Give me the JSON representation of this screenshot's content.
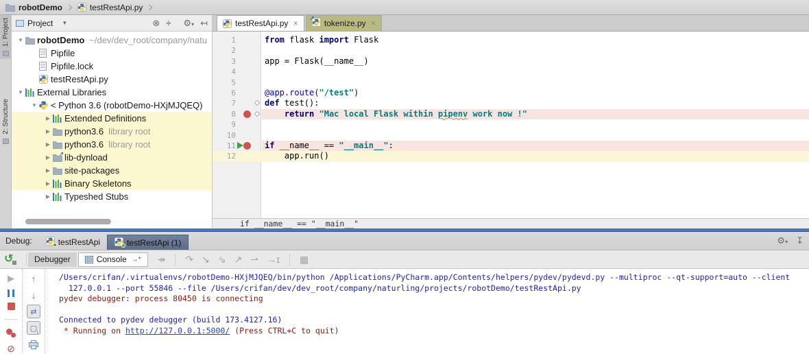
{
  "colors": {
    "keyword": "#000080",
    "string": "#008080",
    "decorator": "#0000b2",
    "breakpoint_line_bg": "#f8e4e0",
    "caret_line_bg": "#fcf6d8",
    "tree_highlight_bg": "#fbf8cf",
    "inactive_tab_bg": "#b9ba7f",
    "selected_debug_tab_bg": "#5d6e88",
    "splitter_accent": "#4678be",
    "console_stdout": "#1e23be",
    "console_stderr": "#8b1a10",
    "breakpoint_red": "#d25252"
  },
  "breadcrumb": {
    "items": [
      {
        "label": "robotDemo",
        "icon": "folder",
        "bold": true
      },
      {
        "label": "testRestApi.py",
        "icon": "python-file",
        "bold": false
      }
    ]
  },
  "tool_strip": {
    "tabs": [
      {
        "label": "1: Project",
        "active": true
      },
      {
        "label": "2: Structure",
        "active": false
      }
    ]
  },
  "project": {
    "title": "Project",
    "header_icons": [
      "locate",
      "collapse-all",
      "sep",
      "gear",
      "hide-left"
    ],
    "tree": [
      {
        "label": "robotDemo",
        "suffix": "~/dev/dev_root/company/natu",
        "icon": "folder",
        "chevron": "down",
        "level": 0,
        "bold": true,
        "hl": false
      },
      {
        "label": "Pipfile",
        "icon": "file",
        "chevron": "",
        "level": 1,
        "hl": false
      },
      {
        "label": "Pipfile.lock",
        "icon": "file",
        "chevron": "",
        "level": 1,
        "hl": false
      },
      {
        "label": "testRestApi.py",
        "icon": "python-file",
        "chevron": "",
        "level": 1,
        "hl": false
      },
      {
        "label": "External Libraries",
        "icon": "library",
        "chevron": "down",
        "level": 0,
        "hl": false
      },
      {
        "label": "< Python 3.6 (robotDemo-HXjMJQEQ)",
        "icon": "python-logo",
        "chevron": "down",
        "level": 1,
        "hl": false
      },
      {
        "label": "Extended Definitions",
        "icon": "library",
        "chevron": "right",
        "level": 2,
        "hl": true
      },
      {
        "label": "python3.6",
        "suffix": "library root",
        "icon": "folder",
        "chevron": "right",
        "level": 2,
        "hl": true
      },
      {
        "label": "python3.6",
        "suffix": "library root",
        "icon": "folder",
        "chevron": "right",
        "level": 2,
        "hl": true
      },
      {
        "label": "lib-dynload",
        "icon": "folder-link",
        "chevron": "right",
        "level": 2,
        "hl": true
      },
      {
        "label": "site-packages",
        "icon": "folder",
        "chevron": "right",
        "level": 2,
        "hl": true
      },
      {
        "label": "Binary Skeletons",
        "icon": "library",
        "chevron": "right",
        "level": 2,
        "hl": true
      },
      {
        "label": "Typeshed Stubs",
        "icon": "library",
        "chevron": "right",
        "level": 2,
        "hl": false
      }
    ]
  },
  "editor": {
    "tabs": [
      {
        "label": "testRestApi.py",
        "icon": "python-file",
        "active": true
      },
      {
        "label": "tokenize.py",
        "icon": "python-file-link",
        "active": false
      }
    ],
    "close_glyph": "✕",
    "lines": [
      {
        "num": 1,
        "tokens": [
          {
            "t": "from",
            "c": "kw"
          },
          {
            "t": " flask ",
            "c": ""
          },
          {
            "t": "import",
            "c": "kw"
          },
          {
            "t": " Flask",
            "c": ""
          }
        ]
      },
      {
        "num": 2,
        "tokens": []
      },
      {
        "num": 3,
        "tokens": [
          {
            "t": "app = Flask(__name__)",
            "c": ""
          }
        ]
      },
      {
        "num": 4,
        "tokens": []
      },
      {
        "num": 5,
        "tokens": []
      },
      {
        "num": 6,
        "tokens": [
          {
            "t": "@app.route(",
            "c": "dec"
          },
          {
            "t": "\"/test\"",
            "c": "str"
          },
          {
            "t": ")",
            "c": "dec"
          }
        ]
      },
      {
        "num": 7,
        "tokens": [
          {
            "t": "def",
            "c": "kw"
          },
          {
            "t": " test():",
            "c": ""
          }
        ],
        "fold": "close"
      },
      {
        "num": 8,
        "tokens": [
          {
            "t": "    ",
            "c": ""
          },
          {
            "t": "return",
            "c": "kw"
          },
          {
            "t": " ",
            "c": ""
          },
          {
            "t": "\"Mac local Flask within ",
            "c": "str"
          },
          {
            "t": "pipenv",
            "c": "str typo"
          },
          {
            "t": " work now !\"",
            "c": "str"
          }
        ],
        "breakpoint": true,
        "band": "pink",
        "fold": "open"
      },
      {
        "num": 9,
        "tokens": []
      },
      {
        "num": 10,
        "tokens": []
      },
      {
        "num": 11,
        "tokens": [
          {
            "t": "if",
            "c": "kw"
          },
          {
            "t": " __name__ == ",
            "c": ""
          },
          {
            "t": "\"__main__\"",
            "c": "str"
          },
          {
            "t": ":",
            "c": ""
          }
        ],
        "breakpoint": true,
        "exec": true,
        "band": "pink"
      },
      {
        "num": 12,
        "tokens": [
          {
            "t": "    app.run()",
            "c": ""
          }
        ],
        "band": "yellow"
      }
    ],
    "context_bar": "if __name__ == \"__main__\""
  },
  "debug": {
    "label": "Debug:",
    "session_tabs": [
      {
        "label": "testRestApi",
        "icon": "python-run",
        "active": false
      },
      {
        "label": "testRestApi (1)",
        "icon": "python-run",
        "active": true
      }
    ],
    "header_icons": [
      "gear",
      "hide-down"
    ],
    "view_tabs": [
      {
        "label": "Debugger",
        "active": false,
        "icon": ""
      },
      {
        "label": "Console",
        "active": true,
        "icon": "console",
        "marker": "→*"
      }
    ],
    "step_icons": [
      "show-execution-point",
      "sep",
      "step-over",
      "step-into",
      "step-into-my-code",
      "step-out",
      "run-to-cursor",
      "evaluate",
      "sep",
      "view-as-table"
    ],
    "left_outer_icons": [
      "resume",
      "pause",
      "stop",
      "sep",
      "view-breakpoints",
      "mute-breakpoints"
    ],
    "left_inner_icons": [
      "stack-up",
      "stack-down",
      "soft-wrap",
      "scroll-to-end",
      "print"
    ],
    "console_lines": [
      {
        "segments": [
          {
            "t": "/Users/crifan/.virtualenvs/robotDemo-HXjMJQEQ/bin/python /Applications/PyCharm.app/Contents/helpers/pydev/pydevd.py --multiproc --qt-support=auto --client",
            "c": "c-blue"
          }
        ]
      },
      {
        "segments": [
          {
            "t": "  127.0.0.1 --port 55846 --file /Users/crifan/dev/dev_root/company/naturling/projects/robotDemo/testRestApi.py",
            "c": "c-blue"
          }
        ]
      },
      {
        "segments": [
          {
            "t": "pydev debugger: process 80450 is connecting",
            "c": "c-red"
          }
        ]
      },
      {
        "segments": []
      },
      {
        "segments": [
          {
            "t": "Connected to pydev debugger (build 173.4127.16)",
            "c": "c-blue"
          }
        ]
      },
      {
        "segments": [
          {
            "t": " * Running on ",
            "c": "c-red"
          },
          {
            "t": "http://127.0.0.1:5000/",
            "c": "c-link"
          },
          {
            "t": " (Press CTRL+C to quit)",
            "c": "c-red"
          }
        ]
      }
    ]
  }
}
